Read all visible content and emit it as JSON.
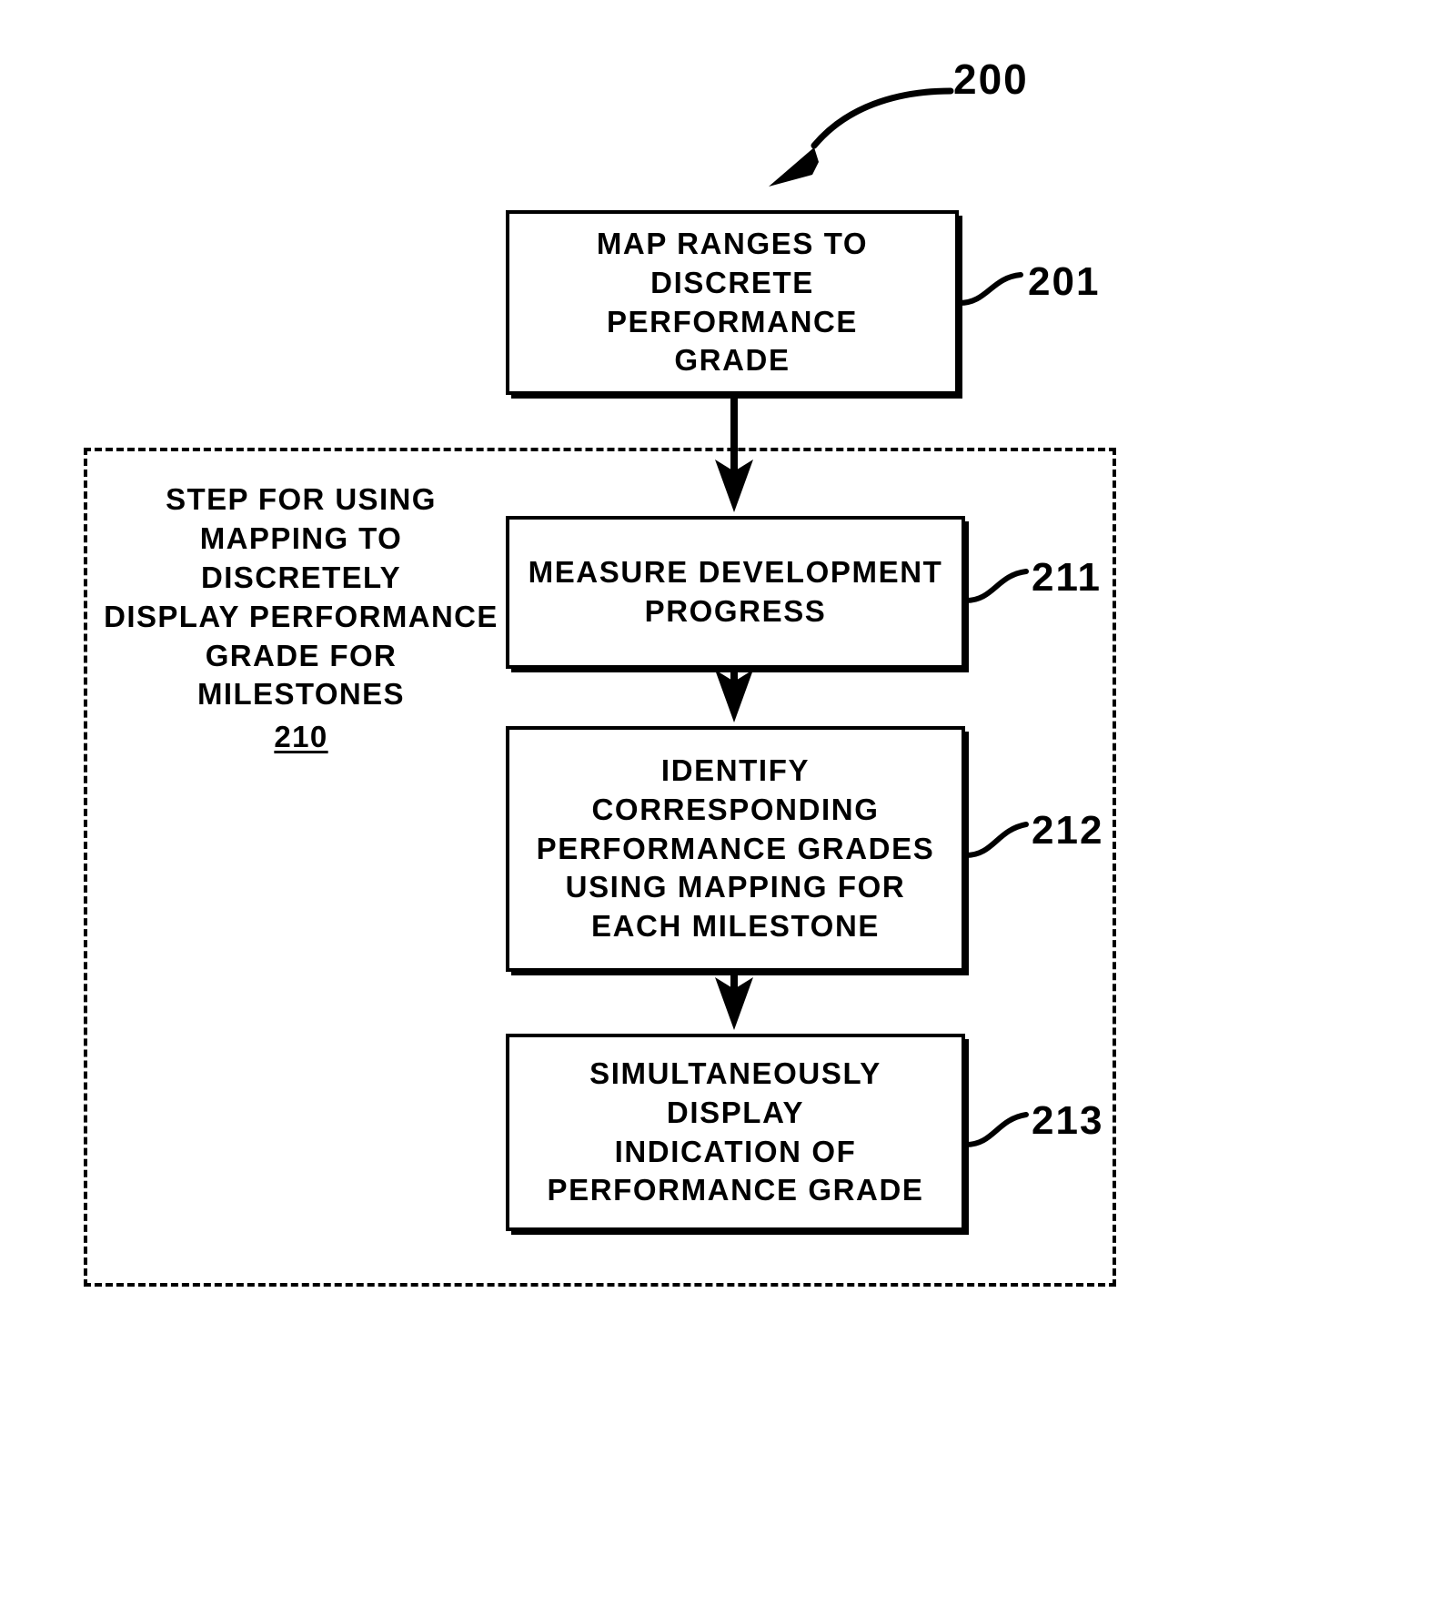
{
  "figure": {
    "reference_number": "200",
    "leader_icon": "curved-arrow-icon"
  },
  "boxes": [
    {
      "id": "201",
      "text": "MAP RANGES TO\nDISCRETE PERFORMANCE\nGRADE",
      "ref": "201"
    },
    {
      "id": "211",
      "text": "MEASURE DEVELOPMENT\nPROGRESS",
      "ref": "211"
    },
    {
      "id": "212",
      "text": "IDENTIFY CORRESPONDING\nPERFORMANCE GRADES\nUSING MAPPING FOR\nEACH MILESTONE",
      "ref": "212"
    },
    {
      "id": "213",
      "text": "SIMULTANEOUSLY DISPLAY\nINDICATION OF\nPERFORMANCE GRADE",
      "ref": "213"
    }
  ],
  "group": {
    "label": "STEP FOR USING\nMAPPING TO DISCRETELY\nDISPLAY PERFORMANCE\nGRADE FOR MILESTONES",
    "reference_number": "210",
    "border_style": "dashed"
  },
  "connectors": [
    {
      "from": "201",
      "to": "211",
      "icon": "down-arrow-icon"
    },
    {
      "from": "211",
      "to": "212",
      "icon": "down-arrow-icon"
    },
    {
      "from": "212",
      "to": "213",
      "icon": "down-arrow-icon"
    }
  ],
  "colors": {
    "ink": "#000000",
    "paper": "#ffffff"
  }
}
